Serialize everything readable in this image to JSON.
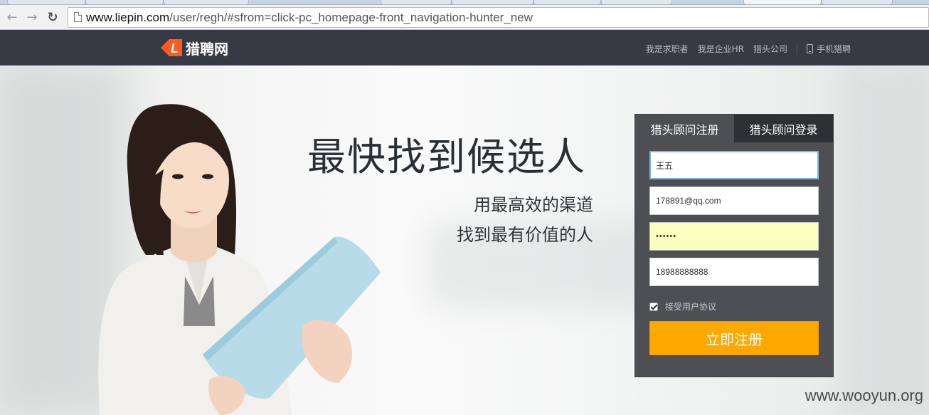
{
  "browser": {
    "url_host": "www.liepin.com",
    "url_path": "/user/regh/#sfrom=click-pc_homepage-front_navigation-hunter_new"
  },
  "header": {
    "logo_letter": "L",
    "logo_text": "猎聘网",
    "nav": {
      "job_seeker": "我是求职者",
      "hr": "我是企业HR",
      "headhunter_company": "猎头公司",
      "mobile": "手机猎聘"
    },
    "colors": {
      "bar": "#363b43",
      "logo_accent": "#ff5a1f"
    }
  },
  "hero": {
    "headline": "最快找到候选人",
    "subline_1": "用最高效的渠道",
    "subline_2": "找到最有价值的人"
  },
  "form": {
    "tab_register": "猎头顾问注册",
    "tab_login": "猎头顾问登录",
    "name_value": "王五",
    "email_value": "178891@qq.com",
    "password_value": "••••••",
    "phone_value": "18988888888",
    "agree_checked": true,
    "agree_label": "接受用户协议",
    "submit_label": "立即注册",
    "colors": {
      "submit": "#ffa800",
      "panel": "#4d4f52"
    }
  },
  "watermark": "www.wooyun.org"
}
